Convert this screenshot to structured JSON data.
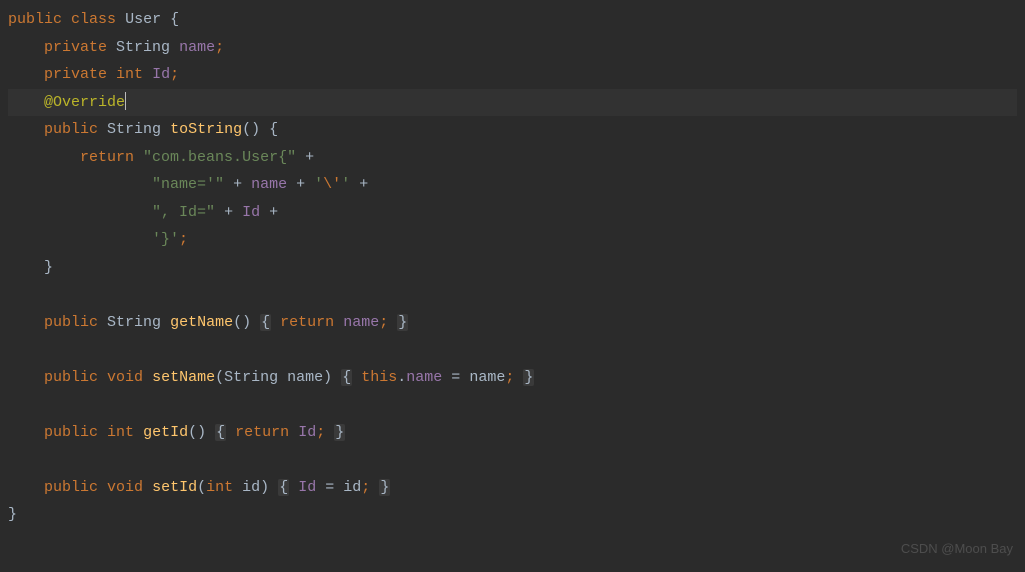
{
  "code": {
    "kw_public": "public",
    "kw_class": "class",
    "kw_private": "private",
    "kw_return": "return",
    "kw_void": "void",
    "kw_int": "int",
    "kw_this": "this",
    "type_string": "String",
    "class_user": "User",
    "field_name": "name",
    "field_id": "Id",
    "param_name": "name",
    "param_id": "id",
    "annotation_override": "@Override",
    "method_tostring": "toString",
    "method_getname": "getName",
    "method_setname": "setName",
    "method_getid": "getId",
    "method_setid": "setId",
    "str_userprefix": "\"com.beans.User{\"",
    "str_nameeq": "\"name='\"",
    "str_esc_quote": "'\\''",
    "str_ideq": "\", Id=\"",
    "str_close": "'}'"
  },
  "punct": {
    "lbrace": "{",
    "rbrace": "}",
    "lparen": "(",
    "rparen": ")",
    "semi": ";",
    "plus": " + ",
    "eq": " = ",
    "dot": "."
  },
  "watermark": "CSDN @Moon Bay",
  "colors": {
    "bg": "#2b2b2b",
    "keyword": "#cc7832",
    "method": "#ffc66d",
    "field": "#9876aa",
    "string": "#6a8759",
    "annotation": "#bbb529",
    "default": "#a9b7c6"
  }
}
